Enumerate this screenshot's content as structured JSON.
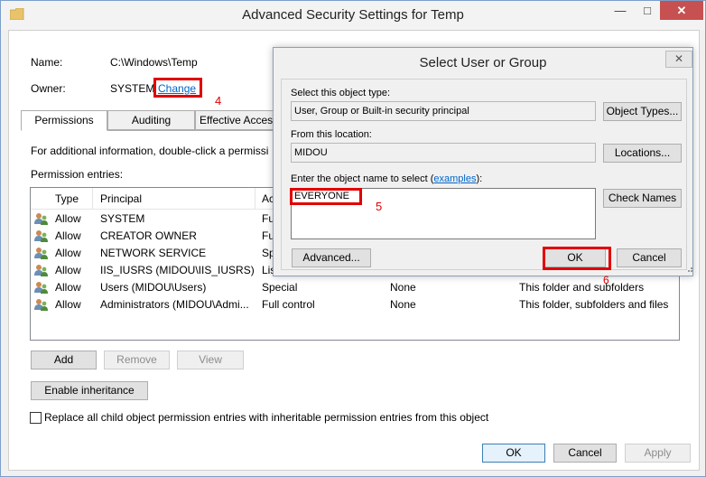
{
  "window": {
    "title": "Advanced Security Settings for Temp",
    "minimize": "—",
    "maximize": "□",
    "close": "✕"
  },
  "header": {
    "name_label": "Name:",
    "name_value": "C:\\Windows\\Temp",
    "owner_label": "Owner:",
    "owner_value": "SYSTEM",
    "change_link": "Change",
    "step4": "4"
  },
  "tabs": [
    {
      "label": "Permissions",
      "selected": true
    },
    {
      "label": "Auditing",
      "selected": false
    },
    {
      "label": "Effective Access",
      "selected": false
    }
  ],
  "permissions": {
    "info_text": "For additional information, double-click a permissi",
    "entries_label": "Permission entries:",
    "columns": [
      "Type",
      "Principal",
      "Ac"
    ],
    "rows": [
      {
        "type": "Allow",
        "principal": "SYSTEM",
        "access": "Ful",
        "inherited": "",
        "applies": ""
      },
      {
        "type": "Allow",
        "principal": "CREATOR OWNER",
        "access": "Ful",
        "inherited": "",
        "applies": ""
      },
      {
        "type": "Allow",
        "principal": "NETWORK SERVICE",
        "access": "Sp",
        "inherited": "",
        "applies": ""
      },
      {
        "type": "Allow",
        "principal": "IIS_IUSRS (MIDOU\\IIS_IUSRS)",
        "access": "Lis",
        "inherited": "",
        "applies": ""
      },
      {
        "type": "Allow",
        "principal": "Users (MIDOU\\Users)",
        "access": "Special",
        "inherited": "None",
        "applies": "This folder and subfolders"
      },
      {
        "type": "Allow",
        "principal": "Administrators (MIDOU\\Admi...",
        "access": "Full control",
        "inherited": "None",
        "applies": "This folder, subfolders and files"
      }
    ],
    "add_label": "Add",
    "remove_label": "Remove",
    "view_label": "View",
    "enable_inheritance_label": "Enable inheritance",
    "replace_label": "Replace all child object permission entries with inheritable permission entries from this object",
    "replace_checked": false
  },
  "footer": {
    "ok_label": "OK",
    "cancel_label": "Cancel",
    "apply_label": "Apply"
  },
  "dialog": {
    "title": "Select User or Group",
    "close": "✕",
    "object_type_label": "Select this object type:",
    "object_type_value": "User, Group or Built-in security principal",
    "object_types_btn": "Object Types...",
    "location_label": "From this location:",
    "location_value": "MIDOU",
    "locations_btn": "Locations...",
    "enter_label_prefix": "Enter the object name to select (",
    "examples_link": "examples",
    "enter_label_suffix": "):",
    "object_name_value": "EVERYONE",
    "step5": "5",
    "check_names_btn": "Check Names",
    "advanced_btn": "Advanced...",
    "ok_btn": "OK",
    "cancel_btn": "Cancel",
    "step6": "6"
  },
  "colors": {
    "annotation_red": "#e00000",
    "link_blue": "#0066cc",
    "close_red": "#c75050"
  }
}
